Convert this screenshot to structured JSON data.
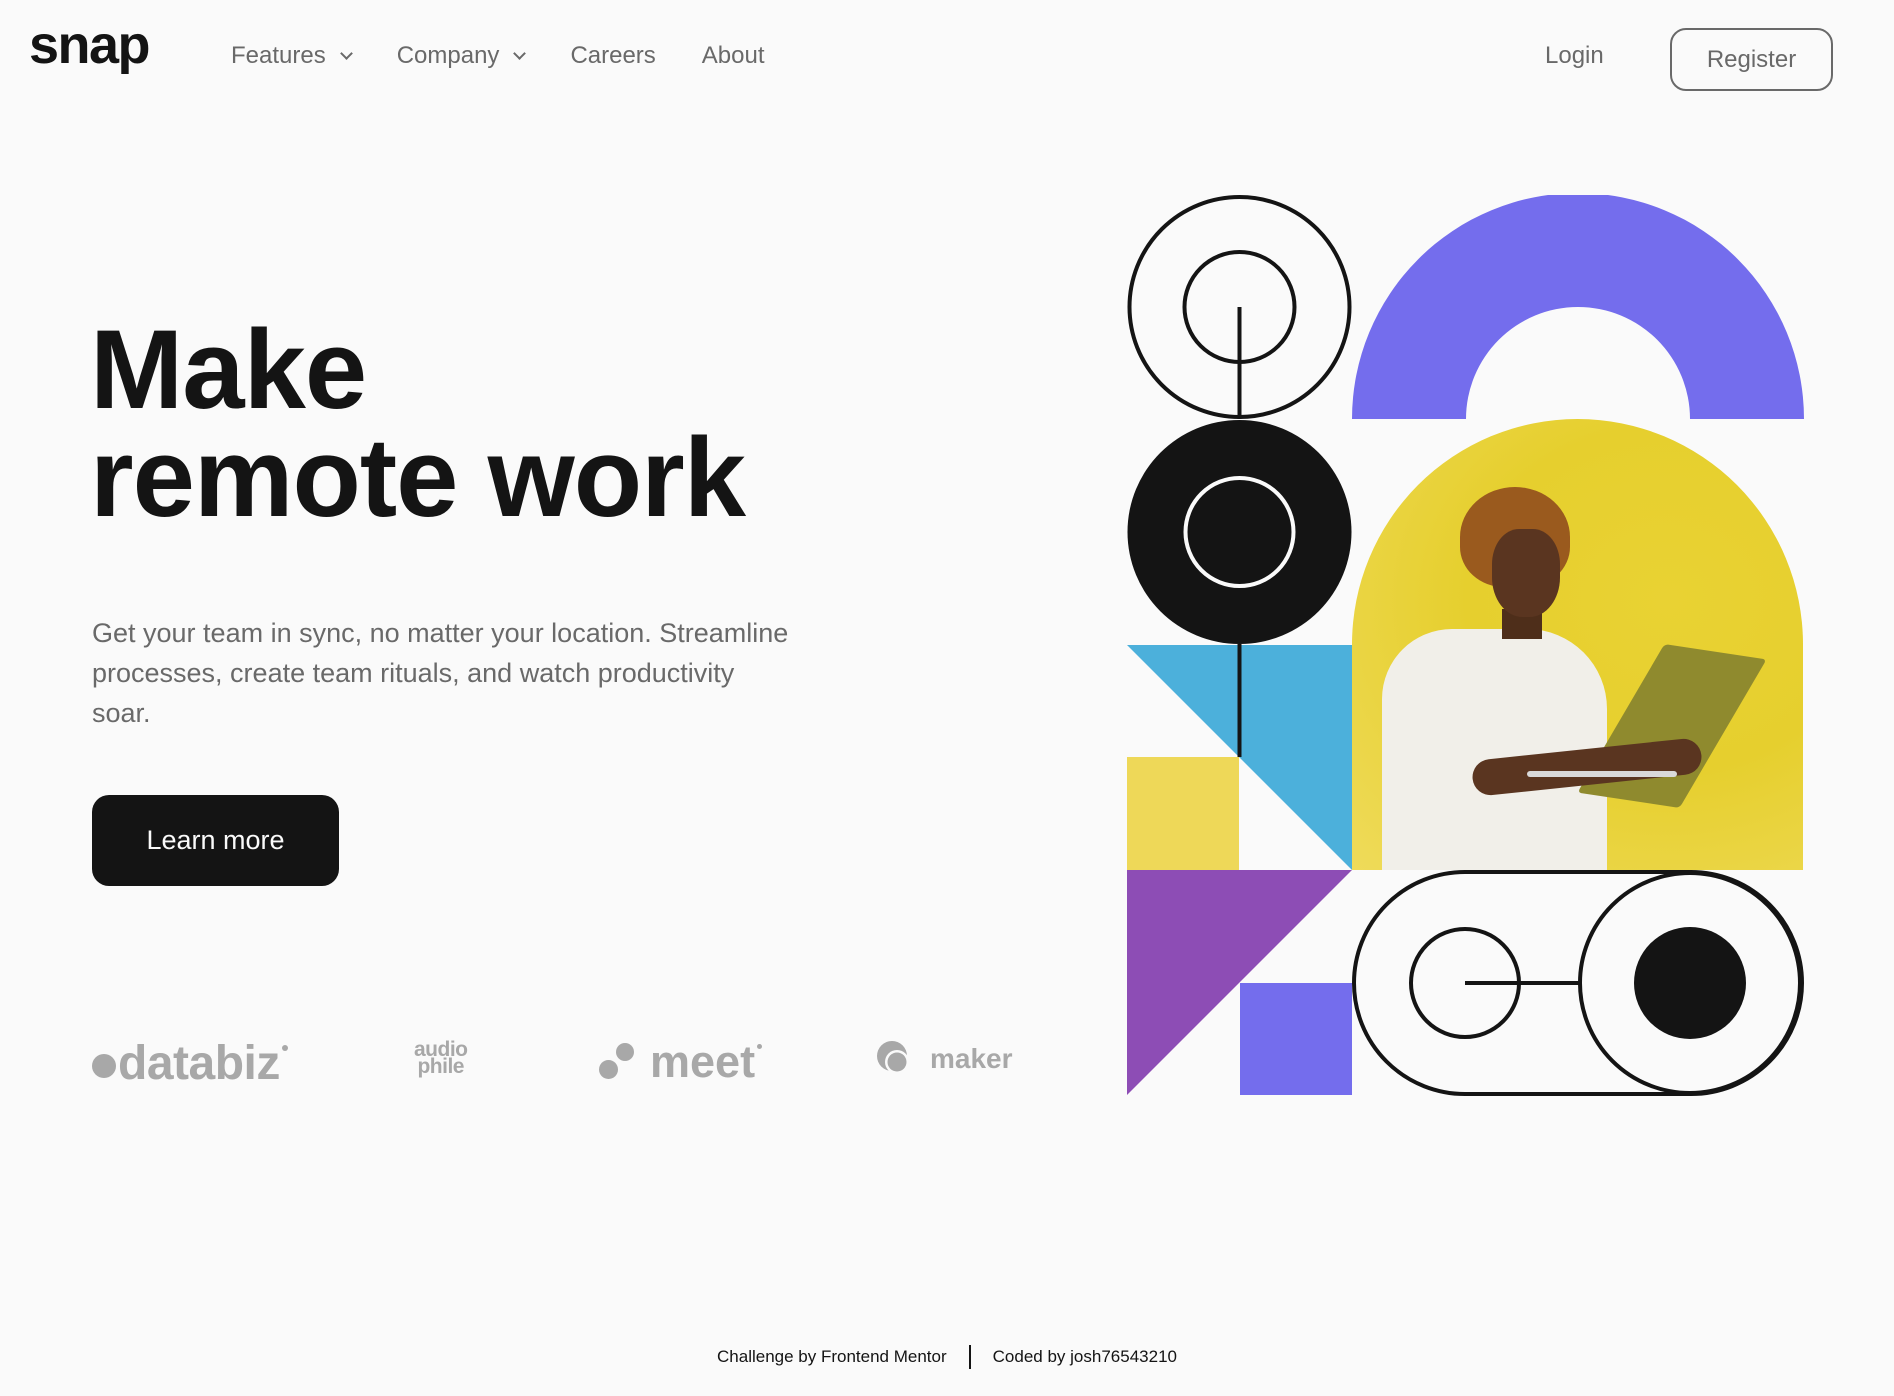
{
  "header": {
    "logo": "snap",
    "nav": [
      {
        "label": "Features",
        "icon": "chevron-down-icon"
      },
      {
        "label": "Company",
        "icon": "chevron-down-icon"
      },
      {
        "label": "Careers"
      },
      {
        "label": "About"
      }
    ],
    "login_label": "Login",
    "register_label": "Register"
  },
  "hero": {
    "title_line1": "Make",
    "title_line2": "remote work",
    "description": "Get your team in sync, no matter your location. Streamline processes, create team rituals, and watch productivity soar.",
    "cta_label": "Learn more"
  },
  "clients": {
    "databiz": "databiz",
    "audiophile_top": "audio",
    "audiophile_bottom": "phile",
    "meet": "meet",
    "maker": "maker"
  },
  "illustration": {
    "photo_alt": "Person holding a laptop against a yellow wall",
    "colors": {
      "black": "#141414",
      "violet": "#746ded",
      "yellow": "#eed858",
      "cyan": "#4cb0db",
      "purple": "#8d4db5"
    }
  },
  "footer": {
    "challenge_text": "Challenge by Frontend Mentor",
    "coded_text": "Coded by josh76543210"
  }
}
